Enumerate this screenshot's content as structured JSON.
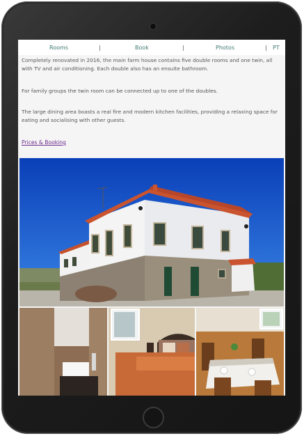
{
  "nav": {
    "rooms": "Rooms",
    "book": "Book",
    "photos": "Photos",
    "lang": "PT",
    "separator": "|"
  },
  "content": {
    "paragraph1": "Completely renovated in 2016, the main farm house contains five double rooms and one twin, all with TV and air conditioning. Each double also has an ensuite bathroom.",
    "paragraph2": "For family groups the twin room can be connected up to one of the doubles.",
    "paragraph3": "The large dining area boasts a real fire and modern kitchen facilities, providing a relaxing space for eating and socialising with other guests.",
    "prices_link": "Prices & Booking"
  },
  "colors": {
    "nav_link": "#3f7a72",
    "body_text": "#555555",
    "visited_link": "#6d2b8f",
    "tablet_frame": "#1d1d1d"
  },
  "icons": [
    "camera-icon",
    "home-button-icon"
  ]
}
